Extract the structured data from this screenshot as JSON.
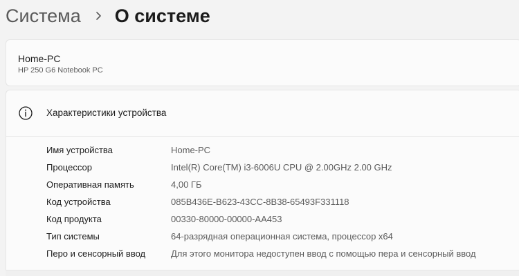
{
  "breadcrumb": {
    "parent": "Система",
    "current": "О системе"
  },
  "device": {
    "name": "Home-PC",
    "model": "HP 250 G6 Notebook PC"
  },
  "specs": {
    "title": "Характеристики устройства",
    "rows": [
      {
        "label": "Имя устройства",
        "value": "Home-PC"
      },
      {
        "label": "Процессор",
        "value": "Intel(R) Core(TM) i3-6006U CPU @ 2.00GHz   2.00 GHz"
      },
      {
        "label": "Оперативная память",
        "value": "4,00 ГБ"
      },
      {
        "label": "Код устройства",
        "value": "085B436E-B623-43CC-8B38-65493F331118"
      },
      {
        "label": "Код продукта",
        "value": "00330-80000-00000-AA453"
      },
      {
        "label": "Тип системы",
        "value": "64-разрядная операционная система, процессор x64"
      },
      {
        "label": "Перо и сенсорный ввод",
        "value": "Для этого монитора недоступен ввод с помощью пера и сенсорный ввод"
      }
    ]
  },
  "icons": {
    "breadcrumb_separator": "chevron-right-icon",
    "specs_header": "info-icon"
  }
}
